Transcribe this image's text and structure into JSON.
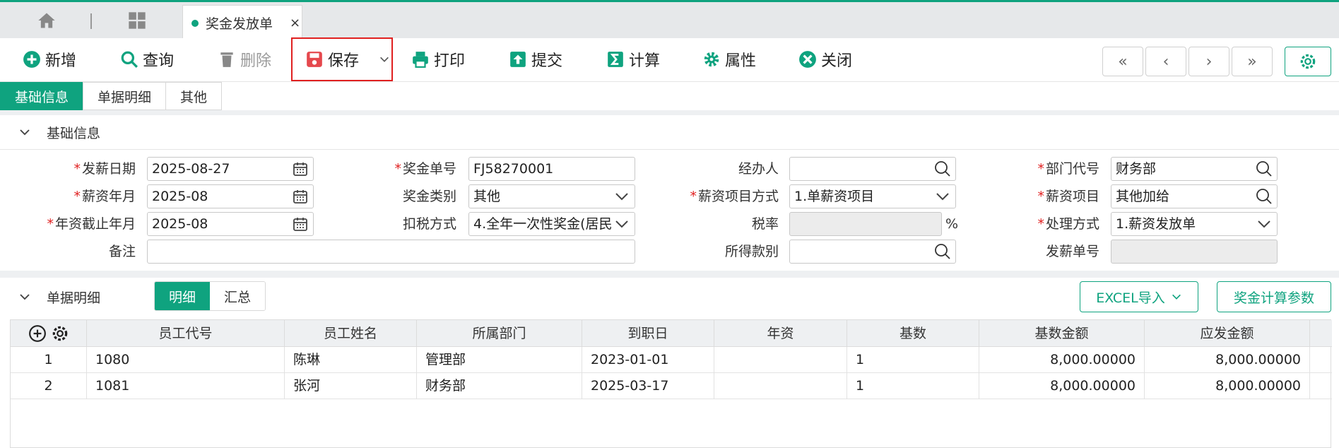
{
  "tabs": {
    "doc_title": "奖金发放单",
    "close_glyph": "×"
  },
  "toolbar": {
    "add": "新增",
    "query": "查询",
    "delete": "删除",
    "save": "保存",
    "print": "打印",
    "submit": "提交",
    "calc": "计算",
    "props": "属性",
    "close": "关闭",
    "nav_first": "«",
    "nav_prev": "‹",
    "nav_next": "›",
    "nav_last": "»"
  },
  "subtabs": [
    "基础信息",
    "单据明细",
    "其他"
  ],
  "basic_section": {
    "title": "基础信息",
    "fields": {
      "pay_date": {
        "label": "发薪日期",
        "value": "2025-08-27"
      },
      "salary_month": {
        "label": "薪资年月",
        "value": "2025-08"
      },
      "seniority_month": {
        "label": "年资截止年月",
        "value": "2025-08"
      },
      "remark": {
        "label": "备注",
        "value": ""
      },
      "bonus_no": {
        "label": "奖金单号",
        "value": "FJ58270001"
      },
      "bonus_type": {
        "label": "奖金类别",
        "value": "其他"
      },
      "tax_method": {
        "label": "扣税方式",
        "value": "4.全年一次性奖金(居民"
      },
      "handler": {
        "label": "经办人",
        "value": ""
      },
      "item_mode": {
        "label": "薪资项目方式",
        "value": "1.单薪资项目"
      },
      "tax_rate": {
        "label": "税率",
        "value": "",
        "unit": "%"
      },
      "income_type": {
        "label": "所得款别",
        "value": ""
      },
      "dept_code": {
        "label": "部门代号",
        "value": "财务部"
      },
      "salary_item": {
        "label": "薪资项目",
        "value": "其他加给"
      },
      "process_mode": {
        "label": "处理方式",
        "value": "1.薪资发放单"
      },
      "pay_no": {
        "label": "发薪单号",
        "value": ""
      }
    }
  },
  "detail_section": {
    "title": "单据明细",
    "toggle": [
      "明细",
      "汇总"
    ],
    "excel_import": "EXCEL导入",
    "bonus_params": "奖金计算参数",
    "columns": [
      "员工代号",
      "员工姓名",
      "所属部门",
      "到职日",
      "年资",
      "基数",
      "基数金额",
      "应发金额"
    ],
    "rows": [
      {
        "idx": "1",
        "emp_id": "1080",
        "name": "陈琳",
        "dept": "管理部",
        "hire_date": "2023-01-01",
        "seniority": "",
        "base": "1",
        "base_amt": "8,000.00000",
        "pay_amt": "8,000.00000"
      },
      {
        "idx": "2",
        "emp_id": "1081",
        "name": "张河",
        "dept": "财务部",
        "hire_date": "2025-03-17",
        "seniority": "",
        "base": "1",
        "base_amt": "8,000.00000",
        "pay_amt": "8,000.00000"
      }
    ]
  },
  "colors": {
    "accent": "#0fa37f",
    "required": "#e02020"
  }
}
